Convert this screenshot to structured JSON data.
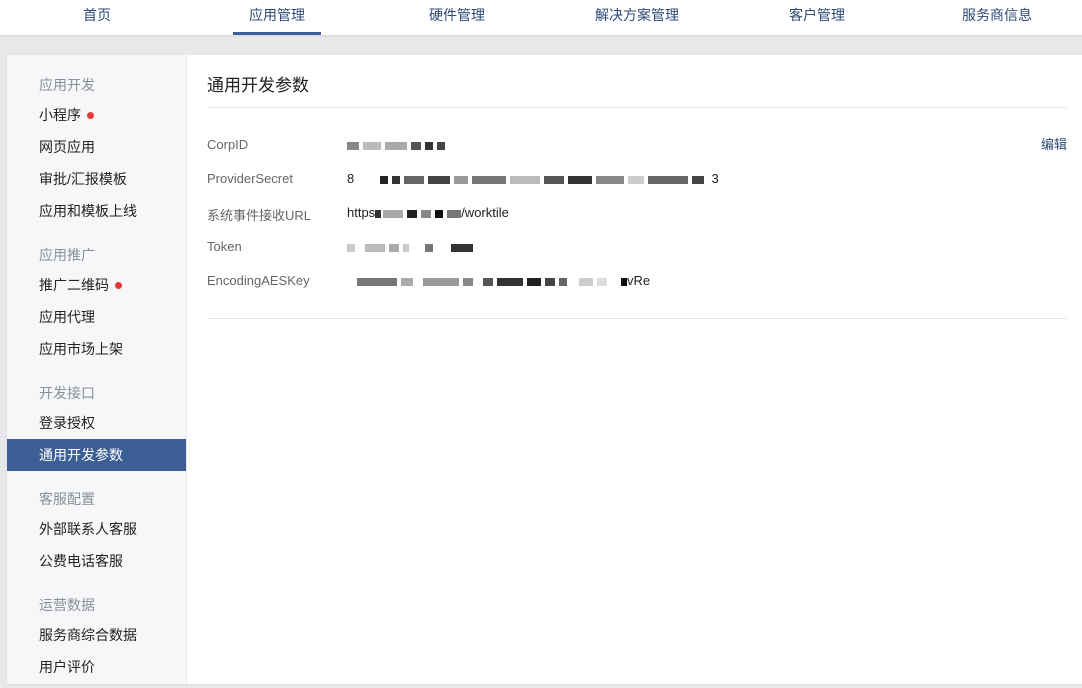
{
  "topnav": {
    "tabs": [
      {
        "label": "首页",
        "active": false
      },
      {
        "label": "应用管理",
        "active": true
      },
      {
        "label": "硬件管理",
        "active": false
      },
      {
        "label": "解决方案管理",
        "active": false
      },
      {
        "label": "客户管理",
        "active": false
      },
      {
        "label": "服务商信息",
        "active": false
      }
    ]
  },
  "sidebar": {
    "sections": [
      {
        "title": "应用开发",
        "items": [
          {
            "label": "小程序",
            "badge": true
          },
          {
            "label": "网页应用"
          },
          {
            "label": "审批/汇报模板"
          },
          {
            "label": "应用和模板上线"
          }
        ]
      },
      {
        "title": "应用推广",
        "items": [
          {
            "label": "推广二维码",
            "badge": true
          },
          {
            "label": "应用代理"
          },
          {
            "label": "应用市场上架"
          }
        ]
      },
      {
        "title": "开发接口",
        "items": [
          {
            "label": "登录授权"
          },
          {
            "label": "通用开发参数",
            "active": true
          }
        ]
      },
      {
        "title": "客服配置",
        "items": [
          {
            "label": "外部联系人客服"
          },
          {
            "label": "公费电话客服"
          }
        ]
      },
      {
        "title": "运营数据",
        "items": [
          {
            "label": "服务商综合数据"
          },
          {
            "label": "用户评价"
          }
        ]
      }
    ]
  },
  "content": {
    "title": "通用开发参数",
    "edit_label": "编辑",
    "rows": [
      {
        "label": "CorpID",
        "value": ""
      },
      {
        "label": "ProviderSecret",
        "value_prefix": "8",
        "value_suffix": "3"
      },
      {
        "label": "系统事件接收URL",
        "value_prefix": "https",
        "value_suffix": "/worktile"
      },
      {
        "label": "Token",
        "value": ""
      },
      {
        "label": "EncodingAESKey",
        "value_suffix": "vRe"
      }
    ]
  },
  "colors": {
    "accent": "#3c5f95",
    "nav_text": "#2f4a77",
    "badge": "#e53935",
    "background": "#e8e8ea"
  }
}
